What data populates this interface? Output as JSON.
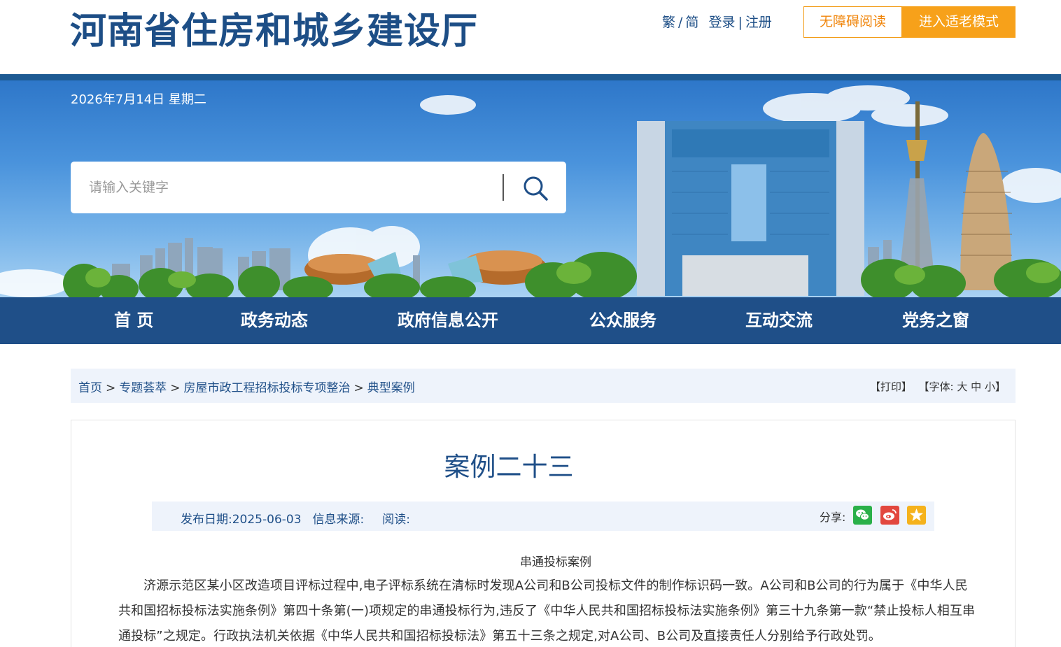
{
  "header": {
    "site_title": "河南省住房和城乡建设厅",
    "trad": "繁",
    "sep1": "/",
    "simp": "简",
    "login": "登录",
    "sep2": "|",
    "register": "注册",
    "accessible_reading": "无障碍阅读",
    "elder_mode": "进入适老模式"
  },
  "banner": {
    "date": "2026年7月14日 星期二",
    "search_placeholder": "请输入关键字",
    "search_icon": "search-icon"
  },
  "nav": {
    "items": [
      {
        "label": "首 页"
      },
      {
        "label": "政务动态"
      },
      {
        "label": "政府信息公开"
      },
      {
        "label": "公众服务"
      },
      {
        "label": "互动交流"
      },
      {
        "label": "党务之窗"
      }
    ]
  },
  "breadcrumb": {
    "items": [
      "首页",
      "专题荟萃",
      "房屋市政工程招标投标专项整治",
      "典型案例"
    ],
    "separator": ">",
    "print": "【打印】",
    "font_prefix": "【字体:",
    "font_large": "大",
    "font_medium": "中",
    "font_small": "小",
    "font_suffix": "】"
  },
  "article": {
    "title": "案例二十三",
    "publish_label": "发布日期:",
    "publish_date": "2025-06-03",
    "source_label": "信息来源:",
    "read_label": "阅读:",
    "share_label": "分享:",
    "share_icons": [
      "wechat-icon",
      "weibo-icon",
      "favorite-icon"
    ],
    "case_heading": "串通投标案例",
    "body": "济源示范区某小区改造项目评标过程中,电子评标系统在清标时发现A公司和B公司投标文件的制作标识码一致。A公司和B公司的行为属于《中华人民共和国招标投标法实施条例》第四十条第(一)项规定的串通投标行为,违反了《中华人民共和国招标投标法实施条例》第三十九条第一款“禁止投标人相互串通投标”之规定。行政执法机关依据《中华人民共和国招标投标法》第五十三条之规定,对A公司、B公司及直接责任人分别给予行政处罚。"
  },
  "colors": {
    "brand_blue": "#1f4f88",
    "accent_orange": "#f7a11a",
    "wechat_green": "#2ab049",
    "weibo_red": "#e2473e",
    "favorite_yellow": "#f5b21c"
  }
}
